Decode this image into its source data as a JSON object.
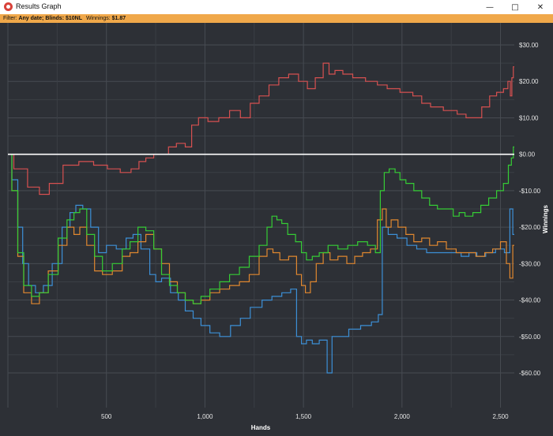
{
  "window": {
    "title": "Results Graph",
    "minimize_icon": "minimize-icon",
    "maximize_icon": "maximize-icon",
    "close_icon": "close-icon"
  },
  "filter": {
    "prefix": "Filter:",
    "date": "Any date;",
    "blinds": "Blinds: $10NL",
    "winnings_label": "Winnings:",
    "winnings_value": "$1.87"
  },
  "colors": {
    "background": "#2d3036",
    "filter_bar": "#f0a84a",
    "red": "#d65050",
    "blue": "#3c8fd6",
    "orange": "#e0872f",
    "green": "#35cc35",
    "zero_line": "#ffffff"
  },
  "chart_data": {
    "type": "line",
    "xlabel": "Hands",
    "ylabel": "Winnings",
    "xlim": [
      0,
      2570
    ],
    "ylim": [
      -64,
      32
    ],
    "xticks": [
      500,
      1000,
      1500,
      2000,
      2500
    ],
    "xtick_labels": [
      "500",
      "1,000",
      "1,500",
      "2,000",
      "2,500"
    ],
    "yticks": [
      30,
      20,
      10,
      0,
      -10,
      -20,
      -30,
      -40,
      -50,
      -60
    ],
    "ytick_labels": [
      "$30.00",
      "$20.00",
      "$10.00",
      "$0.00",
      "-$10.00",
      "-$20.00",
      "-$30.00",
      "-$40.00",
      "-$50.00",
      "-$60.00"
    ],
    "grid": true,
    "series": [
      {
        "key": "red",
        "color": "#d65050",
        "x": [
          0,
          60,
          140,
          180,
          240,
          320,
          400,
          470,
          540,
          600,
          650,
          680,
          720,
          760,
          800,
          830,
          880,
          920,
          945,
          990,
          1040,
          1100,
          1150,
          1210,
          1250,
          1300,
          1350,
          1400,
          1450,
          1500,
          1540,
          1580,
          1620,
          1640,
          1680,
          1720,
          1780,
          1850,
          1900,
          1950,
          2030,
          2080,
          2120,
          2170,
          2250,
          2310,
          2340,
          2380,
          2430,
          2460,
          2500,
          2530,
          2545,
          2555,
          2560,
          2570
        ],
        "values": [
          0,
          -4,
          -9,
          -11,
          -8,
          -3,
          -2,
          -3,
          -4,
          -5,
          -4,
          -2,
          -1,
          0,
          0,
          2,
          3,
          2,
          8,
          10,
          9,
          10,
          12,
          10,
          14,
          16,
          19,
          21,
          22,
          20,
          18,
          21,
          25,
          22,
          23,
          22,
          21,
          20,
          19,
          18,
          17,
          16,
          14,
          13,
          12,
          11,
          10,
          10,
          13,
          16,
          17,
          18,
          20,
          16,
          21,
          24
        ]
      },
      {
        "key": "blue",
        "color": "#3c8fd6",
        "x": [
          0,
          40,
          60,
          90,
          120,
          160,
          200,
          250,
          300,
          330,
          360,
          400,
          440,
          480,
          520,
          580,
          620,
          650,
          700,
          740,
          760,
          800,
          850,
          880,
          920,
          960,
          1000,
          1050,
          1100,
          1160,
          1200,
          1260,
          1320,
          1360,
          1420,
          1450,
          1480,
          1500,
          1530,
          1560,
          1600,
          1640,
          1650,
          1700,
          1760,
          1820,
          1870,
          1890,
          1910,
          1950,
          2000,
          2050,
          2100,
          2150,
          2200,
          2280,
          2320,
          2360,
          2400,
          2450,
          2500,
          2540,
          2555,
          2570
        ],
        "values": [
          0,
          -7,
          -20,
          -30,
          -36,
          -38,
          -36,
          -30,
          -20,
          -16,
          -14,
          -15,
          -20,
          -27,
          -25,
          -26,
          -23,
          -22,
          -26,
          -33,
          -35,
          -34,
          -38,
          -40,
          -43,
          -45,
          -47,
          -49,
          -50,
          -47,
          -45,
          -42,
          -40,
          -39,
          -38,
          -37,
          -50,
          -52,
          -51,
          -52,
          -51,
          -60,
          -50,
          -50,
          -48,
          -47,
          -46,
          -44,
          -20,
          -22,
          -23,
          -25,
          -26,
          -27,
          -27,
          -27,
          -28,
          -27,
          -28,
          -27,
          -26,
          -27,
          -15,
          -22
        ]
      },
      {
        "key": "orange",
        "color": "#e0872f",
        "x": [
          0,
          40,
          60,
          100,
          140,
          180,
          230,
          280,
          320,
          350,
          380,
          420,
          460,
          500,
          560,
          600,
          640,
          680,
          720,
          760,
          800,
          840,
          880,
          920,
          960,
          1000,
          1050,
          1100,
          1150,
          1200,
          1250,
          1300,
          1330,
          1360,
          1400,
          1450,
          1480,
          1500,
          1520,
          1550,
          1580,
          1620,
          1650,
          1700,
          1740,
          1780,
          1820,
          1860,
          1890,
          1910,
          1930,
          1960,
          2000,
          2040,
          2080,
          2120,
          2160,
          2200,
          2250,
          2300,
          2350,
          2400,
          2440,
          2480,
          2520,
          2540,
          2555,
          2570
        ],
        "values": [
          0,
          -10,
          -28,
          -38,
          -41,
          -38,
          -32,
          -25,
          -20,
          -22,
          -20,
          -25,
          -32,
          -33,
          -32,
          -28,
          -27,
          -24,
          -22,
          -26,
          -30,
          -35,
          -38,
          -40,
          -41,
          -40,
          -38,
          -37,
          -36,
          -35,
          -33,
          -28,
          -26,
          -27,
          -29,
          -28,
          -33,
          -36,
          -38,
          -35,
          -30,
          -27,
          -29,
          -28,
          -30,
          -28,
          -27,
          -26,
          -18,
          -15,
          -20,
          -18,
          -20,
          -22,
          -24,
          -23,
          -25,
          -24,
          -26,
          -27,
          -27,
          -28,
          -27,
          -26,
          -24,
          -30,
          -34,
          -25
        ]
      },
      {
        "key": "green",
        "color": "#35cc35",
        "x": [
          0,
          40,
          60,
          100,
          140,
          180,
          230,
          280,
          320,
          350,
          380,
          420,
          460,
          500,
          560,
          600,
          640,
          680,
          720,
          760,
          800,
          840,
          880,
          920,
          960,
          1000,
          1050,
          1100,
          1150,
          1200,
          1250,
          1300,
          1330,
          1350,
          1380,
          1400,
          1440,
          1480,
          1500,
          1530,
          1560,
          1600,
          1650,
          1700,
          1750,
          1800,
          1850,
          1880,
          1900,
          1920,
          1950,
          1980,
          2000,
          2040,
          2080,
          2120,
          2160,
          2200,
          2240,
          2280,
          2300,
          2340,
          2380,
          2420,
          2460,
          2500,
          2530,
          2550,
          2560,
          2570
        ],
        "values": [
          0,
          -10,
          -27,
          -36,
          -39,
          -38,
          -33,
          -23,
          -18,
          -16,
          -15,
          -22,
          -28,
          -32,
          -30,
          -26,
          -24,
          -20,
          -21,
          -26,
          -33,
          -36,
          -38,
          -40,
          -41,
          -39,
          -37,
          -35,
          -33,
          -31,
          -28,
          -25,
          -20,
          -17,
          -18,
          -19,
          -22,
          -24,
          -27,
          -29,
          -28,
          -27,
          -25,
          -26,
          -25,
          -24,
          -25,
          -27,
          -10,
          -5,
          -4,
          -5,
          -7,
          -8,
          -10,
          -12,
          -14,
          -15,
          -15,
          -17,
          -16,
          -17,
          -16,
          -14,
          -12,
          -10,
          -8,
          -3,
          -1,
          2
        ]
      }
    ],
    "zero_line": 0
  }
}
